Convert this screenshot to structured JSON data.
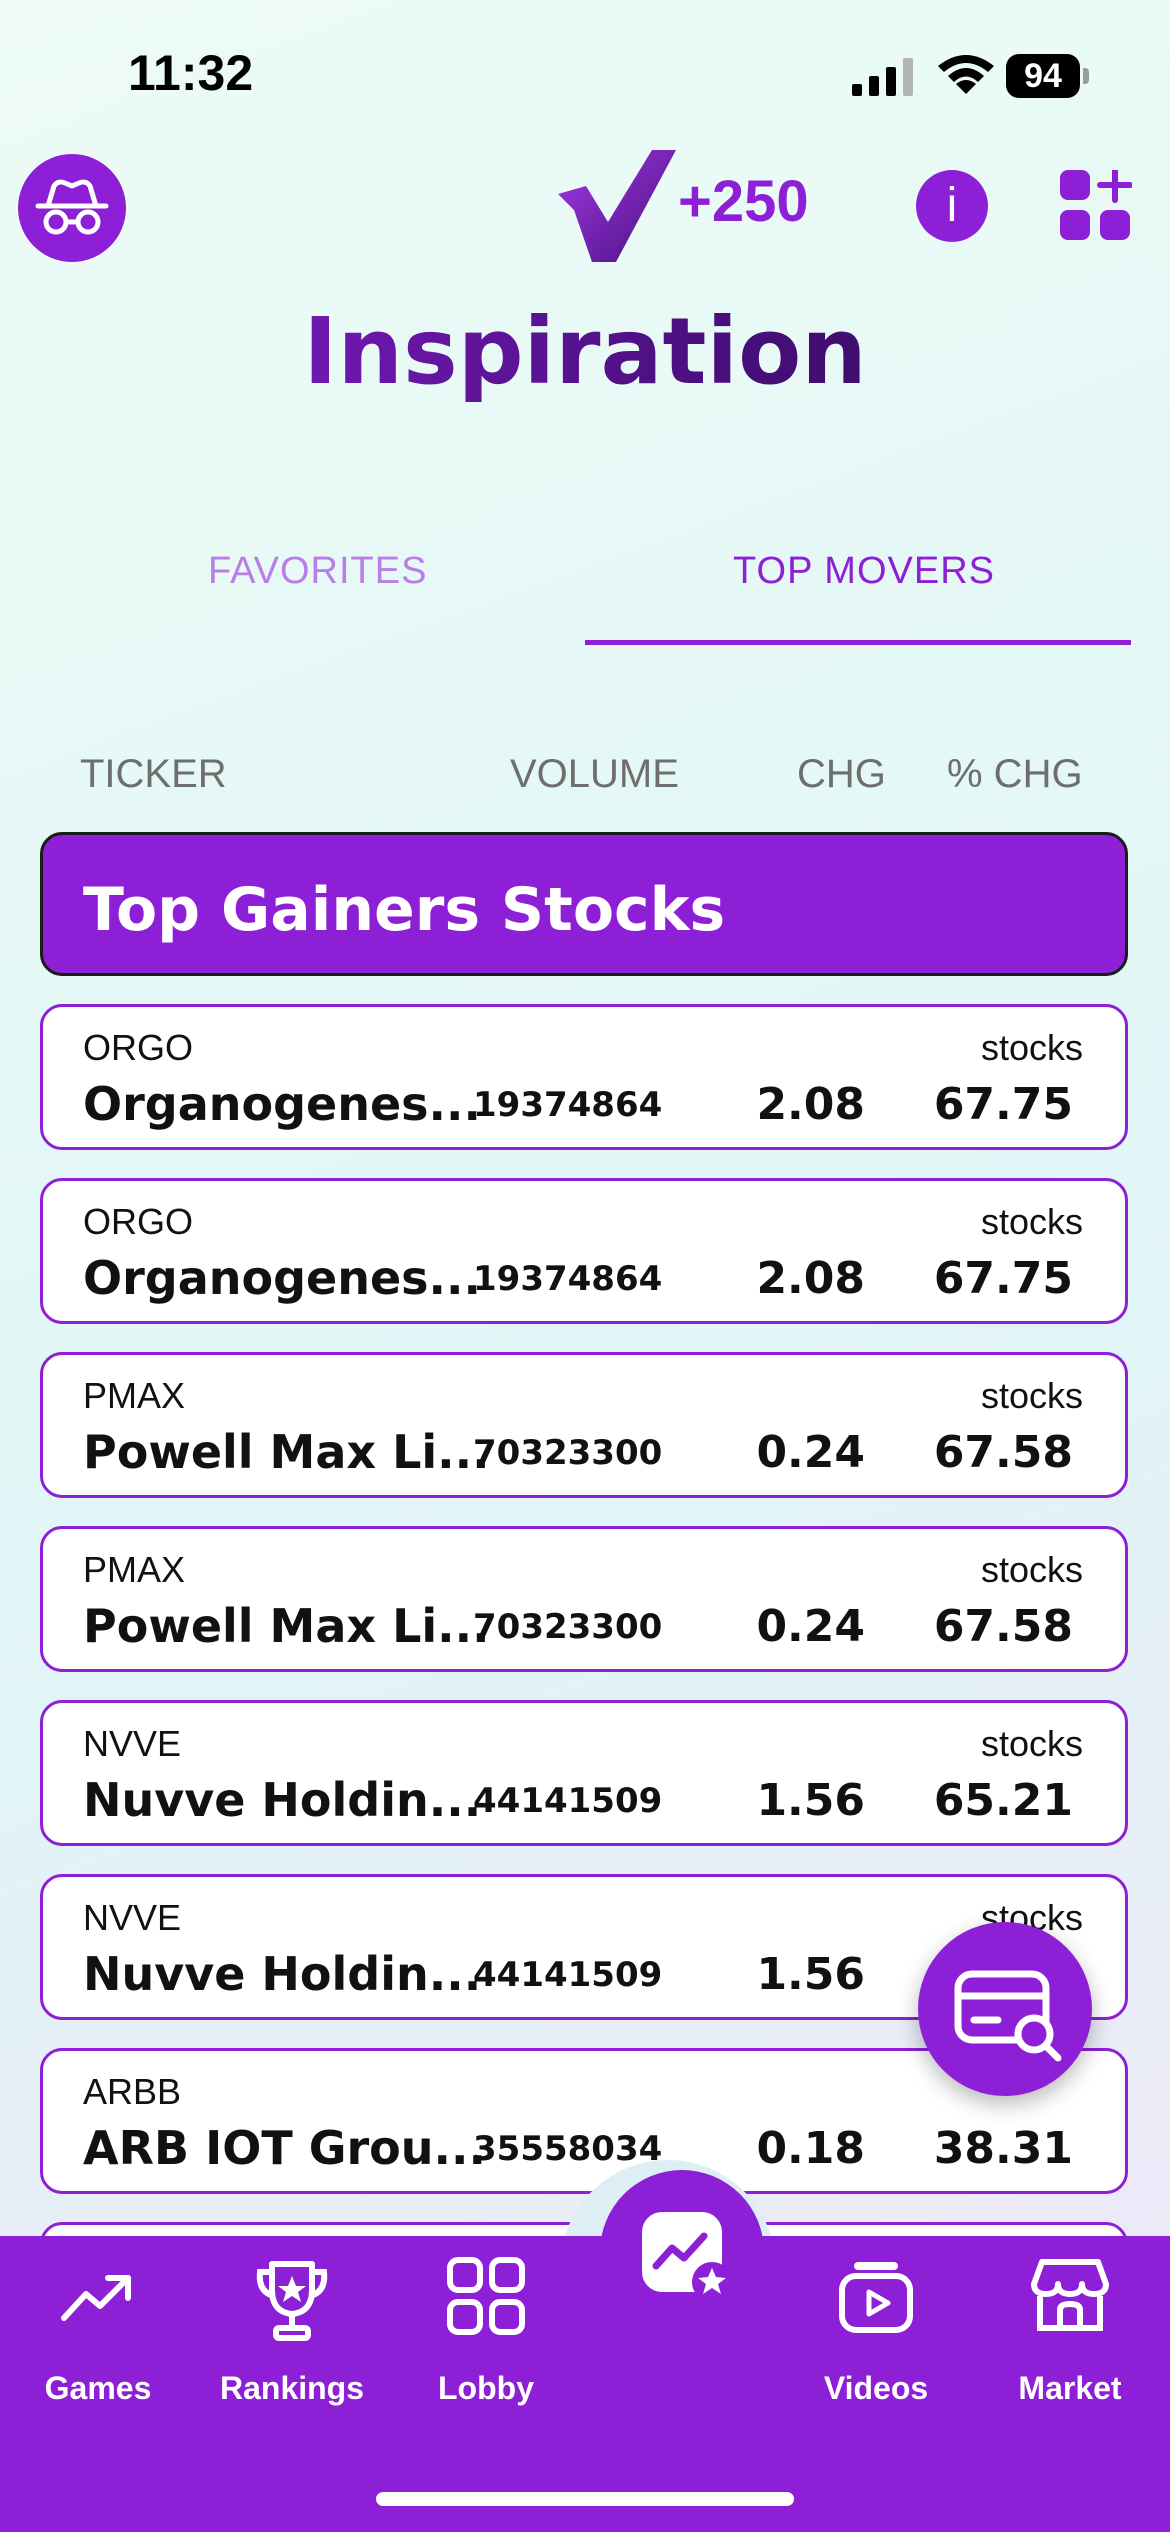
{
  "status": {
    "time": "11:32",
    "battery": "94"
  },
  "header": {
    "points": "+250",
    "info": "i",
    "title": "Inspiration"
  },
  "tabs": [
    {
      "label": "FAVORITES",
      "active": false
    },
    {
      "label": "TOP MOVERS",
      "active": true
    }
  ],
  "columns": {
    "ticker": "TICKER",
    "volume": "VOLUME",
    "chg": "CHG",
    "pchg": "% CHG"
  },
  "section": {
    "title": "Top Gainers Stocks"
  },
  "rows": [
    {
      "ticker": "ORGO",
      "type": "stocks",
      "name": "Organogenes...",
      "volume": "19374864",
      "chg": "2.08",
      "pchg": "67.75"
    },
    {
      "ticker": "ORGO",
      "type": "stocks",
      "name": "Organogenes...",
      "volume": "19374864",
      "chg": "2.08",
      "pchg": "67.75"
    },
    {
      "ticker": "PMAX",
      "type": "stocks",
      "name": "Powell Max Li...",
      "volume": "70323300",
      "chg": "0.24",
      "pchg": "67.58"
    },
    {
      "ticker": "PMAX",
      "type": "stocks",
      "name": "Powell Max Li...",
      "volume": "70323300",
      "chg": "0.24",
      "pchg": "67.58"
    },
    {
      "ticker": "NVVE",
      "type": "stocks",
      "name": "Nuvve Holdin...",
      "volume": "44141509",
      "chg": "1.56",
      "pchg": "65.21"
    },
    {
      "ticker": "NVVE",
      "type": "stocks",
      "name": "Nuvve Holdin...",
      "volume": "44141509",
      "chg": "1.56",
      "pchg": ""
    },
    {
      "ticker": "ARBB",
      "type": "",
      "name": "ARB IOT Grou...",
      "volume": "35558034",
      "chg": "0.18",
      "pchg": "38.31"
    }
  ],
  "nav": {
    "games": "Games",
    "rankings": "Rankings",
    "lobby": "Lobby",
    "videos": "Videos",
    "market": "Market"
  },
  "colors": {
    "primary": "#8d1fd6",
    "title_dark": "#3f0f72"
  },
  "icons": {
    "spy": "spy-incognito-icon",
    "logo": "checkmark-logo-icon",
    "info": "info-icon",
    "add_widget": "add-widget-icon",
    "fab": "card-search-icon",
    "nav_center": "chart-star-icon"
  }
}
